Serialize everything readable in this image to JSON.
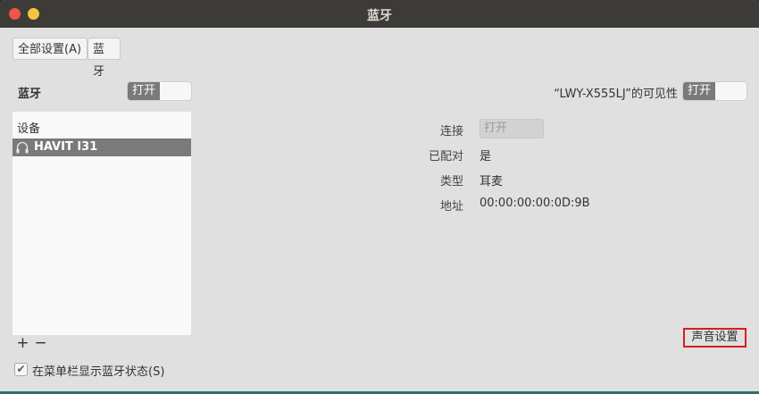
{
  "window": {
    "title": "蓝牙"
  },
  "breadcrumb": {
    "all_settings": "全部设置(A)",
    "current": "蓝牙"
  },
  "bluetooth": {
    "label": "蓝牙",
    "switch_on_text": "打开"
  },
  "visibility": {
    "label": "“LWY-X555LJ”的可见性",
    "switch_on_text": "打开"
  },
  "devices": {
    "header": "设备",
    "items": [
      {
        "name": "HAVIT I31",
        "icon": "headphones-icon",
        "selected": true
      }
    ],
    "add_symbol": "+",
    "remove_symbol": "−"
  },
  "details": {
    "connection_label": "连接",
    "connection_value": "打开",
    "paired_label": "已配对",
    "paired_value": "是",
    "type_label": "类型",
    "type_value": "耳麦",
    "address_label": "地址",
    "address_value": "00:00:00:00:0D:9B"
  },
  "sound_settings_label": "声音设置",
  "show_in_menubar": {
    "checked": true,
    "check_glyph": "✔",
    "label": "在菜单栏显示蓝牙状态(S)"
  },
  "colors": {
    "titlebar": "#3c3b37",
    "close_button": "#f0544c",
    "minimize_button": "#f5c542",
    "highlight_box": "#d32020"
  }
}
